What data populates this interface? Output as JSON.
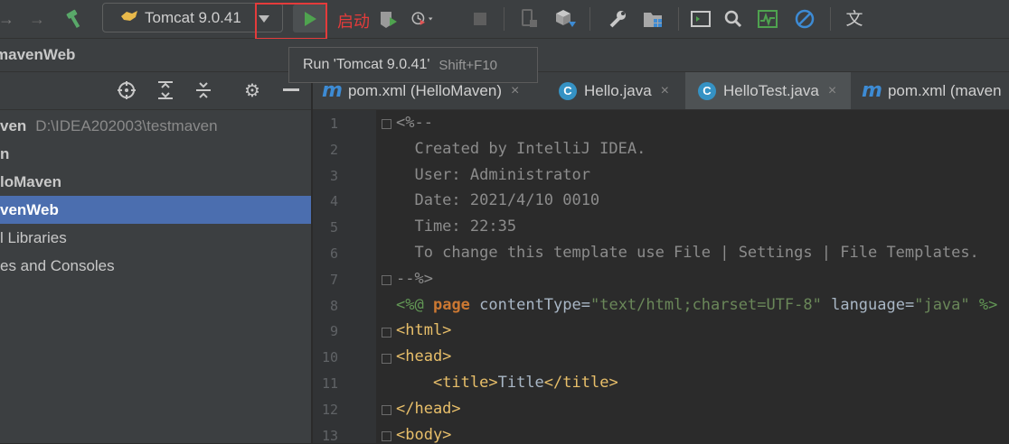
{
  "toolbar": {
    "run_config_label": "Tomcat 9.0.41",
    "annotation": "启动",
    "icons": [
      "arrow-right-icon",
      "build-hammer-icon",
      "run-icon",
      "coverage-icon",
      "profile-icon",
      "stop-icon",
      "device-icon",
      "package-icon",
      "wrench-icon",
      "folder-grid-icon",
      "terminal-icon",
      "search-icon",
      "activity-monitor-icon",
      "no-entry-icon",
      "translate-icon"
    ]
  },
  "tooltip": {
    "text": "Run 'Tomcat 9.0.41'",
    "shortcut": "Shift+F10"
  },
  "nav": {
    "crumb": "mavenWeb"
  },
  "project_tree": {
    "items": [
      {
        "name": "ven",
        "path": "D:\\IDEA202003\\testmaven",
        "bold": true,
        "selected": false
      },
      {
        "name": "n",
        "path": "",
        "bold": true,
        "selected": false
      },
      {
        "name": "loMaven",
        "path": "",
        "bold": true,
        "selected": false
      },
      {
        "name": "venWeb",
        "path": "",
        "bold": true,
        "selected": true
      },
      {
        "name": "l Libraries",
        "path": "",
        "bold": false,
        "selected": false
      },
      {
        "name": "es and Consoles",
        "path": "",
        "bold": false,
        "selected": false
      }
    ]
  },
  "tabs": [
    {
      "icon": "m",
      "label": "pom.xml (HelloMaven)",
      "close": "×",
      "active": false
    },
    {
      "icon": "C",
      "label": "Hello.java",
      "close": "×",
      "active": false
    },
    {
      "icon": "C",
      "label": "HelloTest.java",
      "close": "×",
      "active": true
    },
    {
      "icon": "m",
      "label": "pom.xml (maven",
      "close": "",
      "active": false
    }
  ],
  "editor": {
    "line_numbers": [
      "1",
      "2",
      "3",
      "4",
      "5",
      "6",
      "7",
      "8",
      "9",
      "10",
      "11",
      "12",
      "13"
    ],
    "lines": [
      "<%--",
      "  Created by IntelliJ IDEA.",
      "  User: Administrator",
      "  Date: 2021/4/10 0010",
      "  Time: 22:35",
      "  To change this template use File | Settings | File Templates.",
      "--%>",
      "<%@ page contentType=\"text/html;charset=UTF-8\" language=\"java\" %>",
      "<html>",
      "<head>",
      "    <title>Title</title>",
      "</head>",
      "<body>"
    ]
  },
  "colors": {
    "accent_selection": "#4b6eaf",
    "annotation_red": "#e53b3b",
    "run_green": "#4fa34f"
  }
}
